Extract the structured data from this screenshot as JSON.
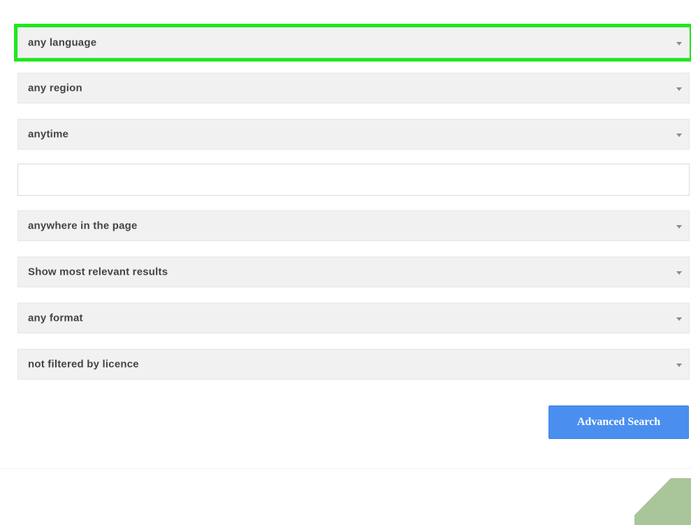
{
  "form": {
    "language": {
      "selected": "any language"
    },
    "region": {
      "selected": "any region"
    },
    "last_update": {
      "selected": "anytime"
    },
    "site_or_domain": {
      "value": "",
      "placeholder": ""
    },
    "terms_appearing": {
      "selected": "anywhere in the page"
    },
    "safe_search": {
      "selected": "Show most relevant results"
    },
    "file_type": {
      "selected": "any format"
    },
    "usage_rights": {
      "selected": "not filtered by licence"
    },
    "submit_label": "Advanced Search"
  },
  "colors": {
    "highlight": "#1ee81e",
    "button": "#4a8ff0",
    "dropdown_bg": "#f1f1f1",
    "decoration": "#a9c59a"
  }
}
